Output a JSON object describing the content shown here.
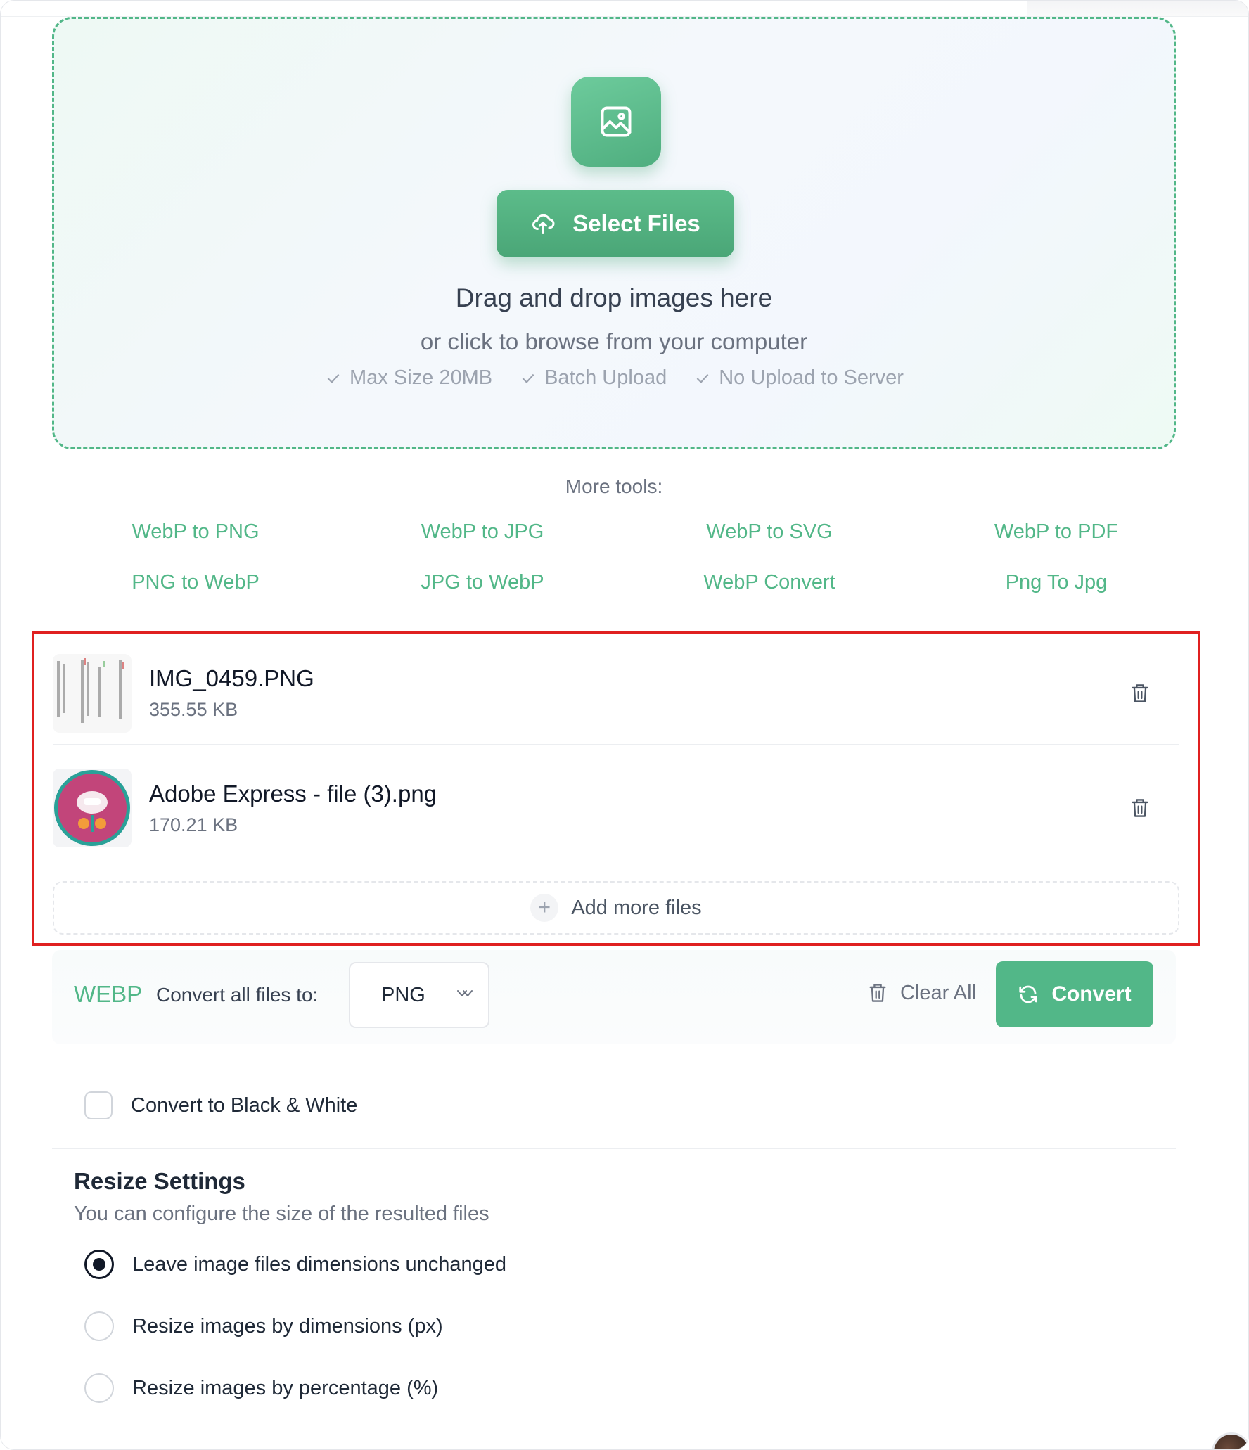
{
  "dropzone": {
    "select_button": "Select Files",
    "title": "Drag and drop images here",
    "subtitle": "or click to browse from your computer",
    "features": [
      "Max Size 20MB",
      "Batch Upload",
      "No Upload to Server"
    ]
  },
  "more_tools": {
    "title": "More tools:",
    "links": [
      "WebP to PNG",
      "WebP to JPG",
      "WebP to SVG",
      "WebP to PDF",
      "PNG to WebP",
      "JPG to WebP",
      "WebP Convert",
      "Png To Jpg"
    ]
  },
  "files": [
    {
      "name": "IMG_0459.PNG",
      "size": "355.55 KB"
    },
    {
      "name": "Adobe Express - file (3).png",
      "size": "170.21 KB"
    }
  ],
  "add_more": "Add more files",
  "convert_bar": {
    "source_format": "WEBP",
    "label": "Convert all files to:",
    "selected_format": "PNG",
    "clear_all": "Clear All",
    "convert": "Convert"
  },
  "options": {
    "black_white": "Convert to Black & White"
  },
  "resize": {
    "title": "Resize Settings",
    "subtitle": "You can configure the size of the resulted files",
    "choices": [
      "Leave image files dimensions unchanged",
      "Resize images by dimensions (px)",
      "Resize images by percentage (%)"
    ],
    "selected_index": 0
  },
  "colors": {
    "accent": "#52b788",
    "highlight_border": "#e02020"
  }
}
